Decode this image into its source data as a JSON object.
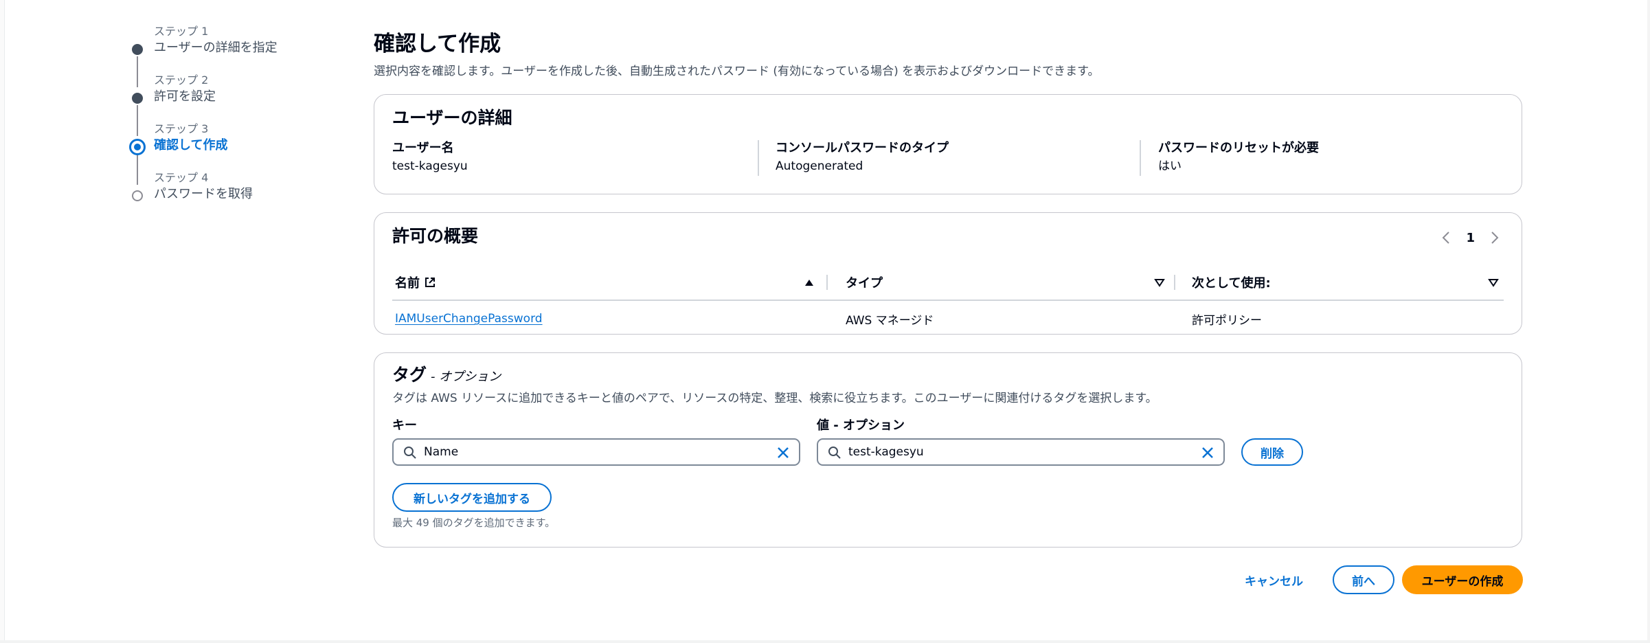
{
  "stepper": [
    {
      "step": "ステップ 1",
      "label": "ユーザーの詳細を指定",
      "status": "done"
    },
    {
      "step": "ステップ 2",
      "label": "許可を設定",
      "status": "done"
    },
    {
      "step": "ステップ 3",
      "label": "確認して作成",
      "status": "current"
    },
    {
      "step": "ステップ 4",
      "label": "パスワードを取得",
      "status": "pending"
    }
  ],
  "header": {
    "title": "確認して作成",
    "description": "選択内容を確認します。ユーザーを作成した後、自動生成されたパスワード (有効になっている場合) を表示およびダウンロードできます。"
  },
  "user_details": {
    "title": "ユーザーの詳細",
    "fields": [
      {
        "label": "ユーザー名",
        "value": "test-kagesyu"
      },
      {
        "label": "コンソールパスワードのタイプ",
        "value": "Autogenerated"
      },
      {
        "label": "パスワードのリセットが必要",
        "value": "はい"
      }
    ]
  },
  "permissions": {
    "title": "許可の概要",
    "page": "1",
    "columns": [
      "名前",
      "タイプ",
      "次として使用:"
    ],
    "rows": [
      {
        "name": "IAMUserChangePassword",
        "type": "AWS マネージド",
        "used_as": "許可ポリシー"
      }
    ]
  },
  "tags": {
    "title": "タグ",
    "optional": "- オプション",
    "description": "タグは AWS リソースに追加できるキーと値のペアで、リソースの特定、整理、検索に役立ちます。このユーザーに関連付けるタグを選択します。",
    "key_label": "キー",
    "value_label": "値 - オプション",
    "key_value": "Name",
    "value_value": "test-kagesyu",
    "remove_label": "削除",
    "add_label": "新しいタグを追加する",
    "limit_text": "最大 49 個のタグを追加できます。"
  },
  "footer": {
    "cancel_label": "キャンセル",
    "prev_label": "前へ",
    "create_label": "ユーザーの作成"
  },
  "colors": {
    "accent": "#0972d3",
    "primary_button": "#ff9900",
    "text": "#000716",
    "border": "#c6c6cd"
  }
}
